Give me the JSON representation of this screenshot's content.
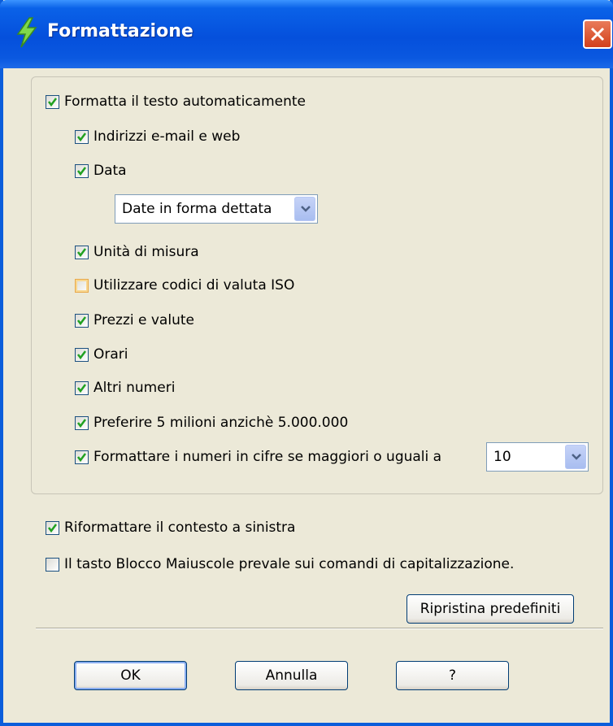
{
  "window": {
    "title": "Formattazione"
  },
  "group": {
    "auto_format": {
      "label": "Formatta il testo automaticamente",
      "checked": true
    },
    "items": [
      {
        "label": "Indirizzi e-mail e web",
        "checked": true
      },
      {
        "label": "Data",
        "checked": true
      },
      {
        "label": "Unità di misura",
        "checked": true
      },
      {
        "label": "Utilizzare codici di valuta ISO",
        "checked": false
      },
      {
        "label": "Prezzi e valute",
        "checked": true
      },
      {
        "label": "Orari",
        "checked": true
      },
      {
        "label": "Altri numeri",
        "checked": true
      },
      {
        "label": "Preferire 5 milioni anzichè 5.000.000",
        "checked": true
      },
      {
        "label": "Formattare i numeri in cifre se maggiori o uguali a",
        "checked": true
      }
    ],
    "date_select": {
      "value": "Date in forma dettata"
    },
    "number_select": {
      "value": "10"
    }
  },
  "options": {
    "reformat_left": {
      "label": "Riformattare il contesto a sinistra",
      "checked": true
    },
    "caps_lock": {
      "label": "Il tasto Blocco Maiuscole prevale sui comandi di capitalizzazione.",
      "checked": false
    }
  },
  "buttons": {
    "restore": "Ripristina predefiniti",
    "ok": "OK",
    "cancel": "Annulla",
    "help": "?"
  },
  "colors": {
    "titlebar": "#0a5ddf",
    "background": "#ece9d8",
    "close": "#d2401c",
    "check": "#21a121"
  },
  "icons": {
    "title": "lightning-icon",
    "close": "close-icon",
    "dropdown": "chevron-down-icon",
    "check": "checkmark-icon"
  }
}
